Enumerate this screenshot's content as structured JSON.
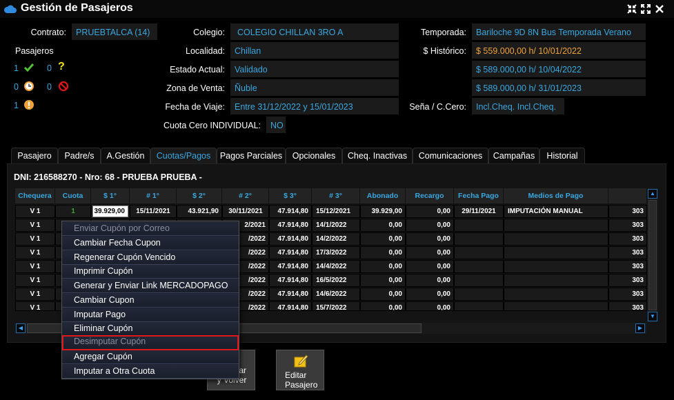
{
  "window": {
    "title": "Gestión de Pasajeros"
  },
  "header": {
    "contrato_label": "Contrato:",
    "contrato": "PRUEBTALCA (14)",
    "colegio_label": "Colegio:",
    "colegio": "COLEGIO CHILLAN 3RO A",
    "temporada_label": "Temporada:",
    "temporada": "Bariloche 9D 8N Bus Temporada Verano",
    "pasajeros_label": "Pasajeros",
    "localidad_label": "Localidad:",
    "localidad": "Chillan",
    "historico_label": "$ Histórico:",
    "historico": "$ 559.000,00 h/ 10/01/2022",
    "estado_label": "Estado Actual:",
    "estado": "Validado",
    "precio2": "$ 589.000,00 h/ 10/04/2022",
    "zona_label": "Zona de Venta:",
    "zona": "Ñuble",
    "precio3": "$ 589.000,00 h/ 31/01/2023",
    "fecha_label": "Fecha de Viaje:",
    "fecha": "Entre 31/12/2022 y 15/01/2023",
    "sena_label": "Seña / C.Cero:",
    "sena": "Incl.Cheq. Incl.Cheq.",
    "cuota_cero_label": "Cuota Cero INDIVIDUAL:",
    "cuota_cero": "NO",
    "counts": {
      "ok": "1",
      "question": "0",
      "clock": "0",
      "blocked": "0",
      "warning": "1"
    }
  },
  "tabs": [
    "Pasajero",
    "Padre/s",
    "A.Gestión",
    "Cuotas/Pagos",
    "Pagos Parciales",
    "Opcionales",
    "Cheq. Inactivas",
    "Comunicaciones",
    "Campañas",
    "Historial"
  ],
  "grid": {
    "dni_line": "DNI: 216588270 - Nro: 68 - PRUEBA  PRUEBA -",
    "columns": [
      "Chequera",
      "Cuota",
      "$ 1°",
      "# 1°",
      "$ 2°",
      "# 2°",
      "$ 3°",
      "# 3°",
      "Abonado",
      "Recargo",
      "Fecha Pago",
      "Medios de Pago"
    ],
    "rows": [
      {
        "chequera": "V 1",
        "cuota": "1",
        "p1": "39.929,00",
        "d1": "15/11/2021",
        "p2": "43.921,90",
        "d2": "30/11/2021",
        "p3": "47.914,80",
        "d3": "15/12/2021",
        "abonado": "39.929,00",
        "recargo": "0,00",
        "fecha_pago": "29/11/2021",
        "medios": "IMPUTACIÓN MANUAL",
        "extra": "303"
      },
      {
        "chequera": "V 1",
        "d2": "2/2021",
        "p3": "47.914,80",
        "d3": "14/1/2022",
        "abonado": "0,00",
        "recargo": "0,00",
        "extra": "303"
      },
      {
        "chequera": "V 1",
        "d2": "/2022",
        "p3": "47.914,80",
        "d3": "14/2/2022",
        "abonado": "0,00",
        "recargo": "0,00",
        "extra": "303"
      },
      {
        "chequera": "V 1",
        "d2": "/2022",
        "p3": "47.914,80",
        "d3": "17/3/2022",
        "abonado": "0,00",
        "recargo": "0,00",
        "extra": "303"
      },
      {
        "chequera": "V 1",
        "d2": "/2022",
        "p3": "47.914,80",
        "d3": "14/4/2022",
        "abonado": "0,00",
        "recargo": "0,00",
        "extra": "303"
      },
      {
        "chequera": "V 1",
        "d2": "/2022",
        "p3": "47.914,80",
        "d3": "16/5/2022",
        "abonado": "0,00",
        "recargo": "0,00",
        "extra": "303"
      },
      {
        "chequera": "V 1",
        "d2": "/2022",
        "p3": "47.914,80",
        "d3": "14/6/2022",
        "abonado": "0,00",
        "recargo": "0,00",
        "extra": "303"
      },
      {
        "chequera": "V 1",
        "d2": "/2022",
        "p3": "47.914,80",
        "d3": "15/7/2022",
        "abonado": "0,00",
        "recargo": "0,00",
        "extra": "303"
      }
    ]
  },
  "context_menu": [
    "Enviar Cupón por Correo",
    "Cambiar Fecha Cupon",
    "Regenerar Cupón Vencido",
    "Imprimir Cupón",
    "Generar y Enviar Link MERCADOPAGO",
    "Cambiar Cupon",
    "Imputar Pago",
    "Eliminar Cupón",
    "Desimputar Cupón",
    "Agregar Cupón",
    "Imputar a Otra Cuota"
  ],
  "buttons": {
    "volver_line1": "ar",
    "volver_line2": "y Volver",
    "editar_line1": "Editar",
    "editar_line2": "Pasajero"
  },
  "colors": {
    "accent": "#39a7e0",
    "orange": "#f0a23a",
    "highlight": "#e0161b"
  }
}
